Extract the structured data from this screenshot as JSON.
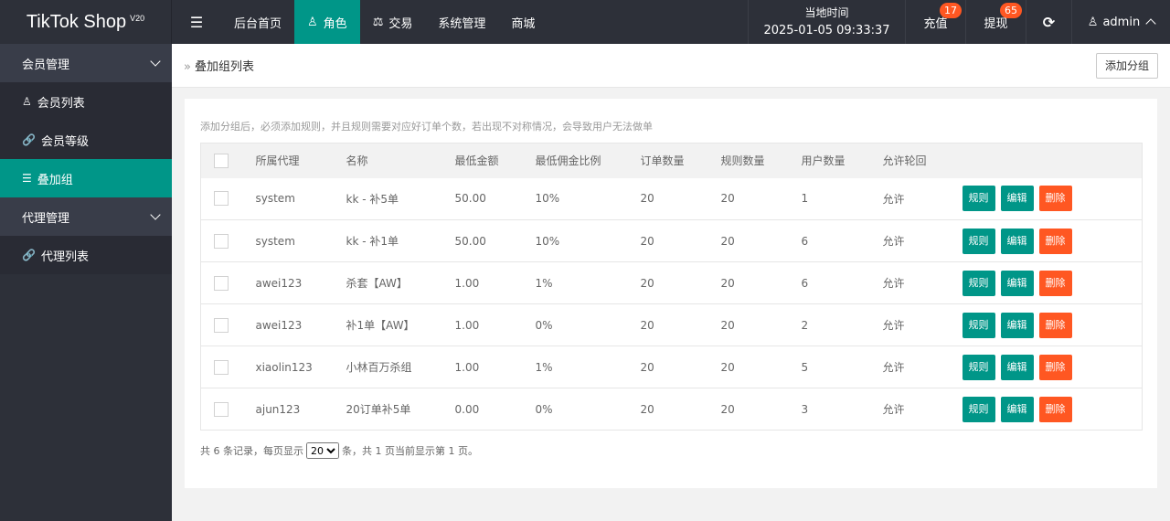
{
  "app": {
    "logo": "TikTok Shop",
    "version": "V20"
  },
  "topnav": {
    "items": [
      {
        "label": "后台首页",
        "icon": ""
      },
      {
        "label": "角色",
        "icon": "user-icon",
        "active": true
      },
      {
        "label": "交易",
        "icon": "scale-icon"
      },
      {
        "label": "系统管理",
        "icon": ""
      },
      {
        "label": "商城",
        "icon": ""
      }
    ]
  },
  "header_right": {
    "time_label": "当地时间",
    "time_value": "2025-01-05 09:33:37",
    "recharge_label": "充值",
    "recharge_badge": "17",
    "withdraw_label": "提现",
    "withdraw_badge": "65",
    "user_name": "admin"
  },
  "sidebar": {
    "member_group": "会员管理",
    "member_list": "会员列表",
    "member_level": "会员等级",
    "stack_group": "叠加组",
    "agent_group": "代理管理",
    "agent_list": "代理列表"
  },
  "page": {
    "breadcrumb": "叠加组列表",
    "add_button": "添加分组",
    "tip": "添加分组后，必须添加规则，并且规则需要对应好订单个数，若出现不对称情况，会导致用户无法做单"
  },
  "table": {
    "headers": [
      "所属代理",
      "名称",
      "最低金额",
      "最低佣金比例",
      "订单数量",
      "规则数量",
      "用户数量",
      "允许轮回"
    ],
    "actions": {
      "rule": "规则",
      "edit": "编辑",
      "delete": "删除"
    },
    "rows": [
      {
        "agent": "system",
        "name": "kk - 补5单",
        "min_amount": "50.00",
        "min_ratio": "10%",
        "orders": "20",
        "rules": "20",
        "users": "1",
        "cycle": "允许"
      },
      {
        "agent": "system",
        "name": "kk - 补1单",
        "min_amount": "50.00",
        "min_ratio": "10%",
        "orders": "20",
        "rules": "20",
        "users": "6",
        "cycle": "允许"
      },
      {
        "agent": "awei123",
        "name": "杀套【AW】",
        "min_amount": "1.00",
        "min_ratio": "1%",
        "orders": "20",
        "rules": "20",
        "users": "6",
        "cycle": "允许"
      },
      {
        "agent": "awei123",
        "name": "补1单【AW】",
        "min_amount": "1.00",
        "min_ratio": "0%",
        "orders": "20",
        "rules": "20",
        "users": "2",
        "cycle": "允许"
      },
      {
        "agent": "xiaolin123",
        "name": "小林百万杀组",
        "min_amount": "1.00",
        "min_ratio": "1%",
        "orders": "20",
        "rules": "20",
        "users": "5",
        "cycle": "允许"
      },
      {
        "agent": "ajun123",
        "name": "20订单补5单",
        "min_amount": "0.00",
        "min_ratio": "0%",
        "orders": "20",
        "rules": "20",
        "users": "3",
        "cycle": "允许"
      }
    ]
  },
  "pager": {
    "prefix": "共 6 条记录，每页显示",
    "page_size": "20",
    "suffix": "条，共 1 页当前显示第 1 页。"
  },
  "colors": {
    "accent": "#009688",
    "danger": "#ff5722",
    "dark": "#2d3039"
  }
}
